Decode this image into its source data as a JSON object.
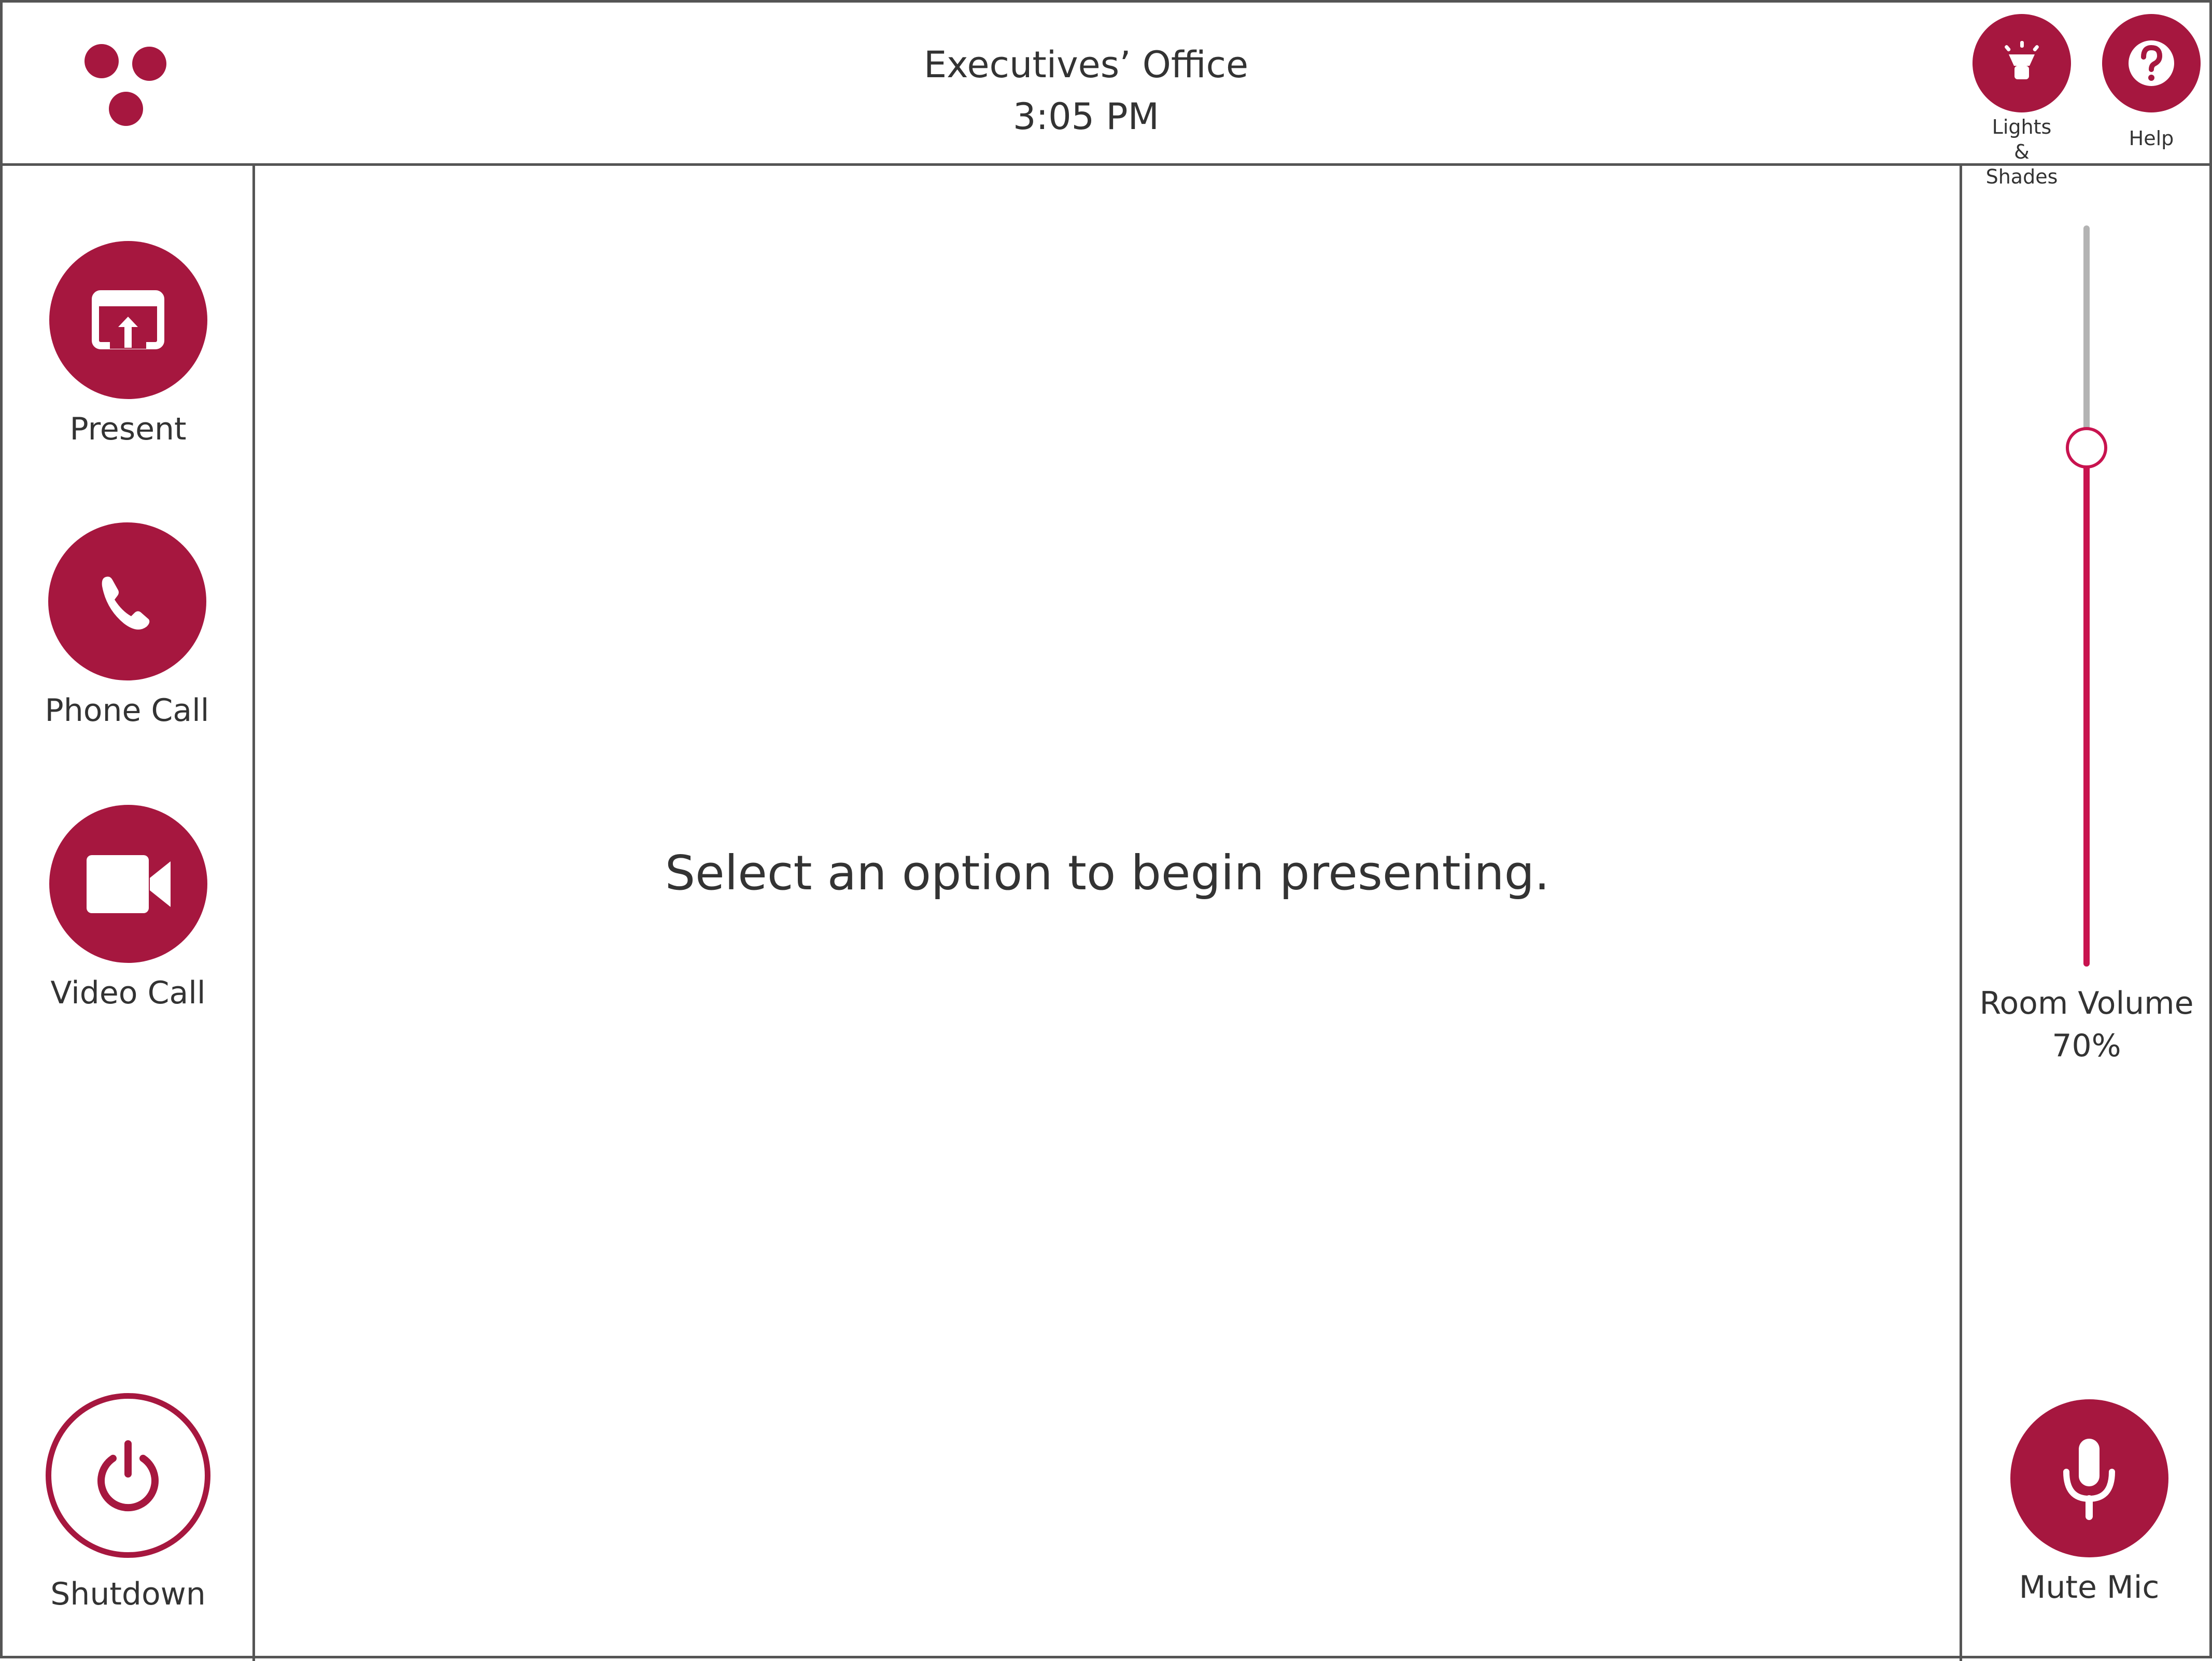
{
  "theme": {
    "accent_color": "#A6173F",
    "slider_fill_color": "#C8134F",
    "slider_track_color": "#B3B3B3",
    "border_color": "#555555",
    "text_color": "#333333"
  },
  "header": {
    "logo_icon": "three-dots-logo-icon",
    "room_name": "Executives’ Office",
    "time": "3:05 PM",
    "buttons": [
      {
        "label": "Lights & Shades",
        "icon": "lamp-icon"
      },
      {
        "label": "Help",
        "icon": "question-mark-icon"
      }
    ]
  },
  "sidebar": {
    "items": [
      {
        "label": "Present",
        "icon": "screen-share-icon"
      },
      {
        "label": "Phone Call",
        "icon": "phone-icon"
      },
      {
        "label": "Video Call",
        "icon": "video-camera-icon"
      }
    ],
    "shutdown": {
      "label": "Shutdown",
      "icon": "power-icon"
    }
  },
  "main": {
    "prompt": "Select an option to begin presenting."
  },
  "volume": {
    "label": "Room Volume",
    "value_text": "70%",
    "level": 0.7
  },
  "mic": {
    "label": "Mute Mic",
    "icon": "microphone-icon"
  }
}
